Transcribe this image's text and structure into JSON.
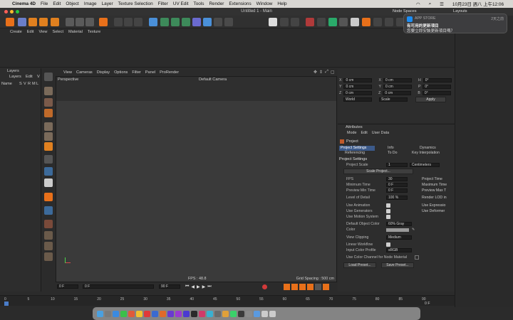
{
  "menubar": {
    "app_name": "Cinema 4D",
    "items": [
      "File",
      "Edit",
      "Object",
      "Image",
      "Layer",
      "Texture Selection",
      "Filter",
      "UV Edit",
      "Tools",
      "Render",
      "Extensions",
      "Window",
      "Help"
    ],
    "clock": "10月23日 週八 上午12:06"
  },
  "window": {
    "title": "Untitled 1 - Main"
  },
  "notification": {
    "source": "APP STORE",
    "time": "2天之前",
    "title": "有可用的更新項目",
    "body": "您要立即安裝更新項目嗎？",
    "overlap_left": "Node Spaces",
    "overlap_right": "Layouts"
  },
  "object_menu": [
    "Create",
    "Edit",
    "View",
    "Select",
    "Material",
    "Texture"
  ],
  "layers_panel": {
    "title": "Layers",
    "menu": [
      "Layers",
      "Edit",
      "V"
    ],
    "columns": [
      "Name",
      "S",
      "V",
      "R",
      "M",
      "L"
    ]
  },
  "viewport": {
    "menu": [
      "View",
      "Cameras",
      "Display",
      "Options",
      "Filter",
      "Panel",
      "ProRender"
    ],
    "view_name": "Perspective",
    "camera": "Default Camera",
    "fps_label": "FPS : 48.8",
    "grid_label": "Grid Spacing : 500 cm"
  },
  "coords": {
    "rows": [
      {
        "a": "X",
        "av": "0 cm",
        "b": "X",
        "bv": "0 cm",
        "c": "H",
        "cv": "0°"
      },
      {
        "a": "Y",
        "av": "0 cm",
        "b": "Y",
        "bv": "0 cm",
        "c": "P",
        "cv": "0°"
      },
      {
        "a": "Z",
        "av": "0 cm",
        "b": "Z",
        "bv": "0 cm",
        "c": "B",
        "cv": "0°"
      }
    ],
    "world": "World",
    "scale": "Scale",
    "apply": "Apply"
  },
  "attributes": {
    "title": "Attributes",
    "menu": [
      "Mode",
      "Edit",
      "User Data"
    ],
    "object_label": "Project",
    "tabs_row1": [
      "Project Settings",
      "Info",
      "Dynamics"
    ],
    "tabs_row2": [
      "Referencing",
      "To Do",
      "Key Interpolation"
    ],
    "section": "Project Settings",
    "project_scale_label": "Project Scale",
    "project_scale_value": "1",
    "project_scale_unit": "Centimeters",
    "scale_project_btn": "Scale Project...",
    "fps_label": "FPS",
    "fps_value": "30",
    "min_time_label": "Minimum Time",
    "min_time_value": "0 F",
    "preview_min_label": "Preview Min Time",
    "preview_min_value": "0 F",
    "lod_label": "Level of Detail",
    "lod_value": "100 %",
    "right_col": [
      "Project Time",
      "Maximum Time",
      "Preview Max T",
      "Render LOD in"
    ],
    "use_animation": "Use Animation",
    "use_generators": "Use Generators",
    "use_motion": "Use Motion System",
    "use_expression": "Use Expressio",
    "use_deformers": "Use Deformer",
    "default_color_label": "Default Object Color",
    "default_color_value": "60% Gray",
    "color_label": "Color",
    "view_clipping_label": "View Clipping",
    "view_clipping_value": "Medium",
    "linear_workflow": "Linear Workflow",
    "input_color_label": "Input Color Profile",
    "input_color_value": "sRGB",
    "color_channel": "Use Color Channel for Node Material",
    "load_preset": "Load Preset...",
    "save_preset": "Save Preset..."
  },
  "timeline_controls": {
    "start": "0 F",
    "cur_a": "0 F",
    "end_a": "90 F",
    "end_b": "90 F"
  },
  "ruler": {
    "ticks": [
      "0",
      "5",
      "10",
      "15",
      "20",
      "25",
      "30",
      "35",
      "40",
      "45",
      "50",
      "55",
      "60",
      "65",
      "70",
      "75",
      "80",
      "85",
      "90"
    ],
    "current": "0 F"
  },
  "colors": {
    "accent_orange": "#e8701a",
    "accent_blue": "#4a7dc9",
    "tab_active": "#3c5a8a"
  }
}
